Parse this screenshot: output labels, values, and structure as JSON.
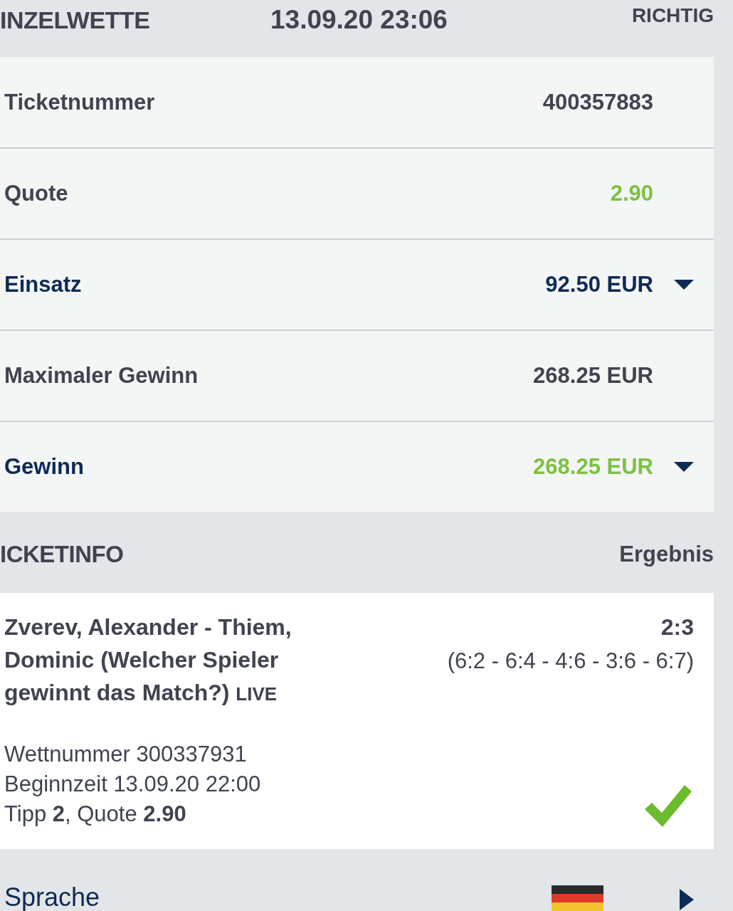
{
  "header": {
    "title": "INZELWETTE",
    "datetime": "13.09.20 23:06",
    "status": "RICHTIG"
  },
  "summary": {
    "rows": [
      {
        "label": "Ticketnummer",
        "value": "400357883",
        "kind": "plain",
        "color": "#3f4450"
      },
      {
        "label": "Quote",
        "value": "2.90",
        "kind": "plain",
        "color": "#7cc142"
      },
      {
        "label": "Einsatz",
        "value": "92.50 EUR",
        "kind": "expandable",
        "color": "#0d2b55"
      },
      {
        "label": "Maximaler Gewinn",
        "value": "268.25 EUR",
        "kind": "plain",
        "color": "#3f4450"
      },
      {
        "label": "Gewinn",
        "value": "268.25 EUR",
        "kind": "expandable",
        "color": "#7cc142"
      }
    ]
  },
  "ticketinfo": {
    "title": "ICKETINFO",
    "result_heading": "Ergebnis",
    "bets": [
      {
        "event": "Zverev, Alexander - Thiem, Dominic (Welcher Spieler gewinnt das Match?)",
        "badge": "LIVE",
        "score": "2:3",
        "sets": "(6:2 - 6:4 - 4:6 - 3:6 - 6:7)",
        "details": [
          "Wettnummer 300337931",
          "Beginnzeit 13.09.20 22:00",
          "Tipp **2**, Quote **2.90**"
        ],
        "won": true
      }
    ]
  },
  "footer": {
    "label": "Sprache"
  }
}
